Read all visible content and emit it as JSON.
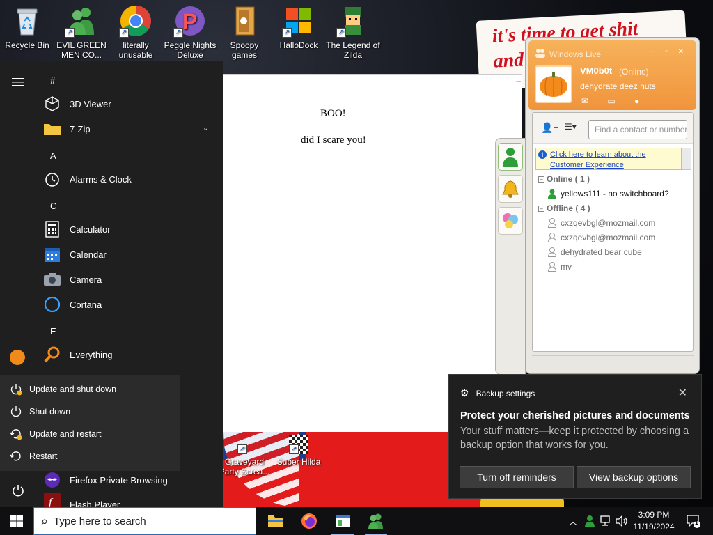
{
  "desktop": {
    "banner_line1": "it's time to get shit",
    "banner_line2": "and",
    "icons": [
      {
        "label": "Recycle Bin"
      },
      {
        "label": "EVIL GREEN MEN CO..."
      },
      {
        "label": "literally unusable"
      },
      {
        "label": "Peggle Nights Deluxe"
      },
      {
        "label": "Spoopy games"
      },
      {
        "label": "HalloDock"
      },
      {
        "label": "The Legend of Zilda"
      }
    ],
    "lower_icons": [
      {
        "label": "Graveyard Party Screa..."
      },
      {
        "label": "Super Hilda"
      }
    ]
  },
  "doc_window": {
    "line1": "BOO!",
    "line2": "did I scare you!",
    "minimize": "–"
  },
  "messenger": {
    "title": "Windows Live",
    "display_name": "VM0b0t",
    "status": "(Online)",
    "personal_message": "dehydrate deez nuts",
    "search_placeholder": "Find a contact or number...",
    "info_link": "Click here to learn about the Customer Experience",
    "groups": [
      {
        "label": "Online ( 1 )",
        "contacts": [
          "yellows111 - no switchboard?"
        ]
      },
      {
        "label": "Offline ( 4 )",
        "contacts": [
          "cxzqevbgl@mozmail.com",
          "cxzqevbgl@mozmail.com",
          "dehydrated bear cube",
          "mv"
        ]
      }
    ],
    "accent": "#f0943c"
  },
  "start_menu": {
    "letters": [
      "#",
      "A",
      "C",
      "E"
    ],
    "apps": [
      {
        "label": "3D Viewer",
        "icon": "cube-icon"
      },
      {
        "label": "7-Zip",
        "icon": "folder-icon",
        "expandable": true
      },
      {
        "label": "Alarms & Clock",
        "icon": "clock-icon"
      },
      {
        "label": "Calculator",
        "icon": "calculator-icon"
      },
      {
        "label": "Calendar",
        "icon": "calendar-icon"
      },
      {
        "label": "Camera",
        "icon": "camera-icon"
      },
      {
        "label": "Cortana",
        "icon": "cortana-icon"
      },
      {
        "label": "Everything",
        "icon": "magnifier-icon"
      },
      {
        "label": "Firefox Private Browsing",
        "icon": "firefox-private-icon"
      },
      {
        "label": "Flash Player",
        "icon": "flash-icon"
      }
    ],
    "power_menu": [
      {
        "label": "Update and shut down"
      },
      {
        "label": "Shut down"
      },
      {
        "label": "Update and restart"
      },
      {
        "label": "Restart"
      }
    ]
  },
  "toast": {
    "app": "Backup settings",
    "title": "Protect your cherished pictures and documents",
    "body": "Your stuff matters—keep it protected by choosing a backup option that works for you.",
    "btn_turn_off": "Turn off reminders",
    "btn_view": "View backup options"
  },
  "taskbar": {
    "search_placeholder": "Type here to search",
    "time": "3:09 PM",
    "date": "11/19/2024",
    "notification_count": "1"
  }
}
